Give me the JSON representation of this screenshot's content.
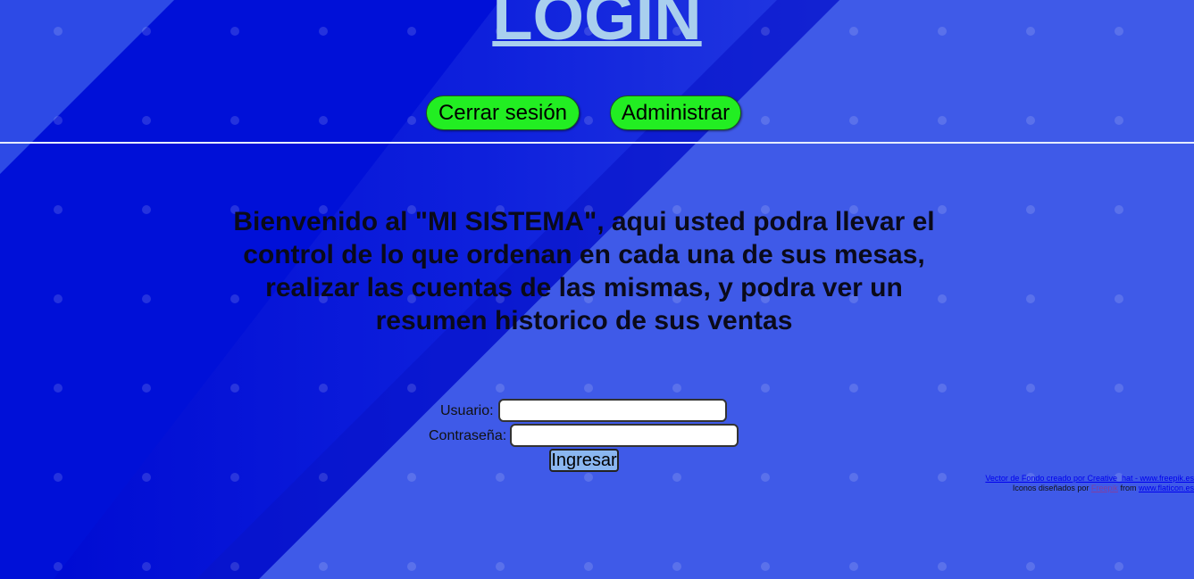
{
  "header": {
    "title": "LOGIN"
  },
  "nav": {
    "logout_label": "Cerrar sesión",
    "admin_label": "Administrar"
  },
  "welcome": {
    "text": "Bienvenido al \"MI SISTEMA\", aqui usted podra llevar el control de lo que ordenan en cada una de sus mesas, realizar las cuentas de las mismas, y podra ver un resumen historico de sus ventas"
  },
  "form": {
    "user_label": "Usuario:",
    "user_value": "",
    "password_label": "Contraseña:",
    "password_value": "",
    "submit_label": "Ingresar"
  },
  "credits": {
    "background_link": "Vector de Fondo creado por Creative_hat - www.freepik.es",
    "icons_prefix": "Iconos diseñados por",
    "freepik_link": "Freepik",
    "from_text": "from",
    "flaticon_link": "www.flaticon.es"
  },
  "colors": {
    "background": "#3f5ae8",
    "stripe_dark": "#0010d8",
    "title": "#a9cfee",
    "nav_button": "#22ee22",
    "submit_button": "#8ab6f0"
  }
}
